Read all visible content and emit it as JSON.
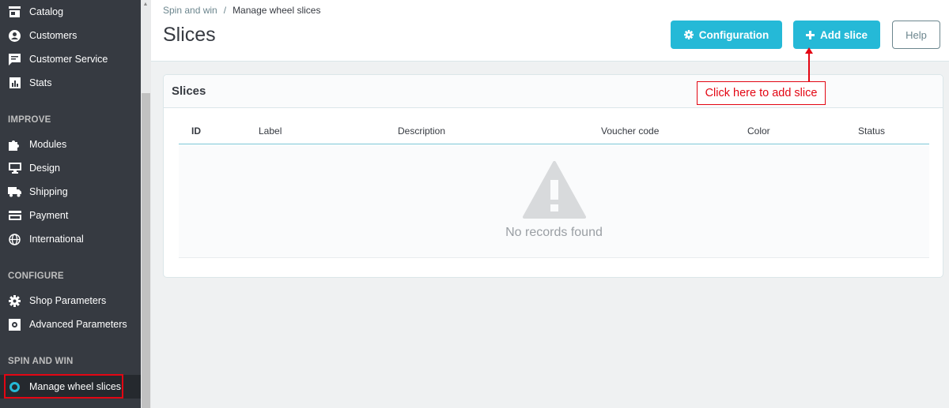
{
  "sidebar": {
    "items_top": [
      {
        "label": "Catalog",
        "icon": "store-icon"
      },
      {
        "label": "Customers",
        "icon": "user-circle-icon"
      },
      {
        "label": "Customer Service",
        "icon": "chat-icon"
      },
      {
        "label": "Stats",
        "icon": "bar-chart-icon"
      }
    ],
    "section_improve": "IMPROVE",
    "items_improve": [
      {
        "label": "Modules",
        "icon": "puzzle-icon"
      },
      {
        "label": "Design",
        "icon": "monitor-icon"
      },
      {
        "label": "Shipping",
        "icon": "truck-icon"
      },
      {
        "label": "Payment",
        "icon": "credit-card-icon"
      },
      {
        "label": "International",
        "icon": "globe-icon"
      }
    ],
    "section_configure": "CONFIGURE",
    "items_configure": [
      {
        "label": "Shop Parameters",
        "icon": "gear-icon"
      },
      {
        "label": "Advanced Parameters",
        "icon": "settings-box-icon"
      }
    ],
    "section_spin": "SPIN AND WIN",
    "items_spin": [
      {
        "label": "Manage wheel slices",
        "icon": "circle-icon"
      }
    ],
    "accent_color": "#25b9d7",
    "highlight_color": "#e30613"
  },
  "header": {
    "breadcrumb": [
      "Spin and win",
      "/",
      "Manage wheel slices"
    ],
    "title": "Slices",
    "buttons": {
      "configuration": "Configuration",
      "add_slice": "Add slice",
      "help": "Help"
    }
  },
  "panel": {
    "heading": "Slices",
    "columns": [
      "ID",
      "Label",
      "Description",
      "Voucher code",
      "Color",
      "Status"
    ],
    "empty_text": "No records found"
  },
  "annotation": {
    "callout": "Click here to add slice"
  }
}
